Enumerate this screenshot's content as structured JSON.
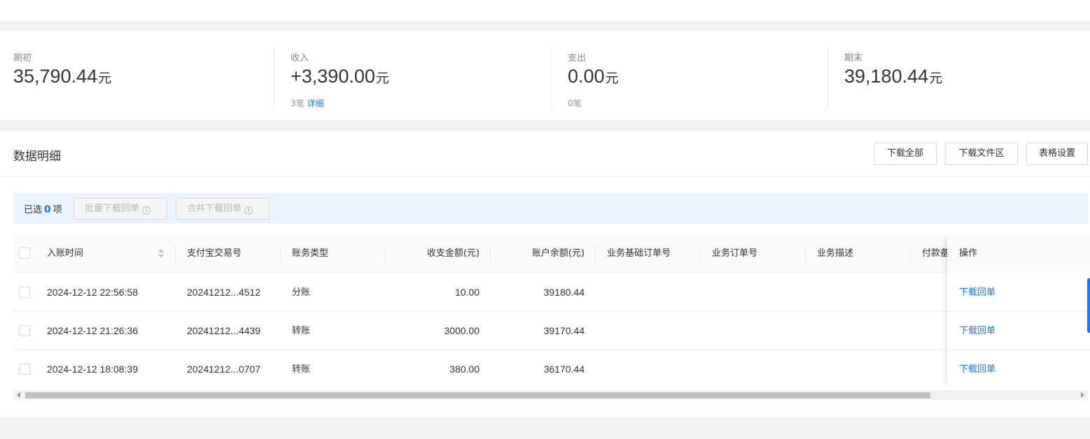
{
  "summary": {
    "opening": {
      "label": "期初",
      "value": "35,790.44",
      "unit": "元"
    },
    "income": {
      "label": "收入",
      "value": "+3,390.00",
      "unit": "元",
      "count": "3笔",
      "detail_link": "详细"
    },
    "expense": {
      "label": "支出",
      "value": "0.00",
      "unit": "元",
      "count": "0笔"
    },
    "closing": {
      "label": "期末",
      "value": "39,180.44",
      "unit": "元"
    }
  },
  "detail": {
    "title": "数据明细",
    "buttons": {
      "download_all": "下载全部",
      "download_area": "下载文件区",
      "table_settings": "表格设置"
    }
  },
  "selection": {
    "prefix": "已选",
    "count": "0",
    "suffix": "项",
    "batch_download": "批量下载回单",
    "merge_download": "合并下载回单"
  },
  "table": {
    "columns": [
      "入账时间",
      "支付宝交易号",
      "账务类型",
      "收支金额(元)",
      "账户余额(元)",
      "业务基础订单号",
      "业务订单号",
      "业务描述",
      "付款备",
      "操作"
    ],
    "rows": [
      {
        "time": "2024-12-12 22:56:58",
        "trade_no": "20241212...4512",
        "type": "分账",
        "amount": "10.00",
        "balance": "39180.44",
        "action": "下载回单"
      },
      {
        "time": "2024-12-12 21:26:36",
        "trade_no": "20241212...4439",
        "type": "转账",
        "amount": "3000.00",
        "balance": "39170.44",
        "action": "下载回单"
      },
      {
        "time": "2024-12-12 18:08:39",
        "trade_no": "20241212...0707",
        "type": "转账",
        "amount": "380.00",
        "balance": "36170.44",
        "action": "下载回单"
      }
    ]
  },
  "colors": {
    "accent": "#1677ff",
    "selection_bg": "#eaf3ff"
  }
}
